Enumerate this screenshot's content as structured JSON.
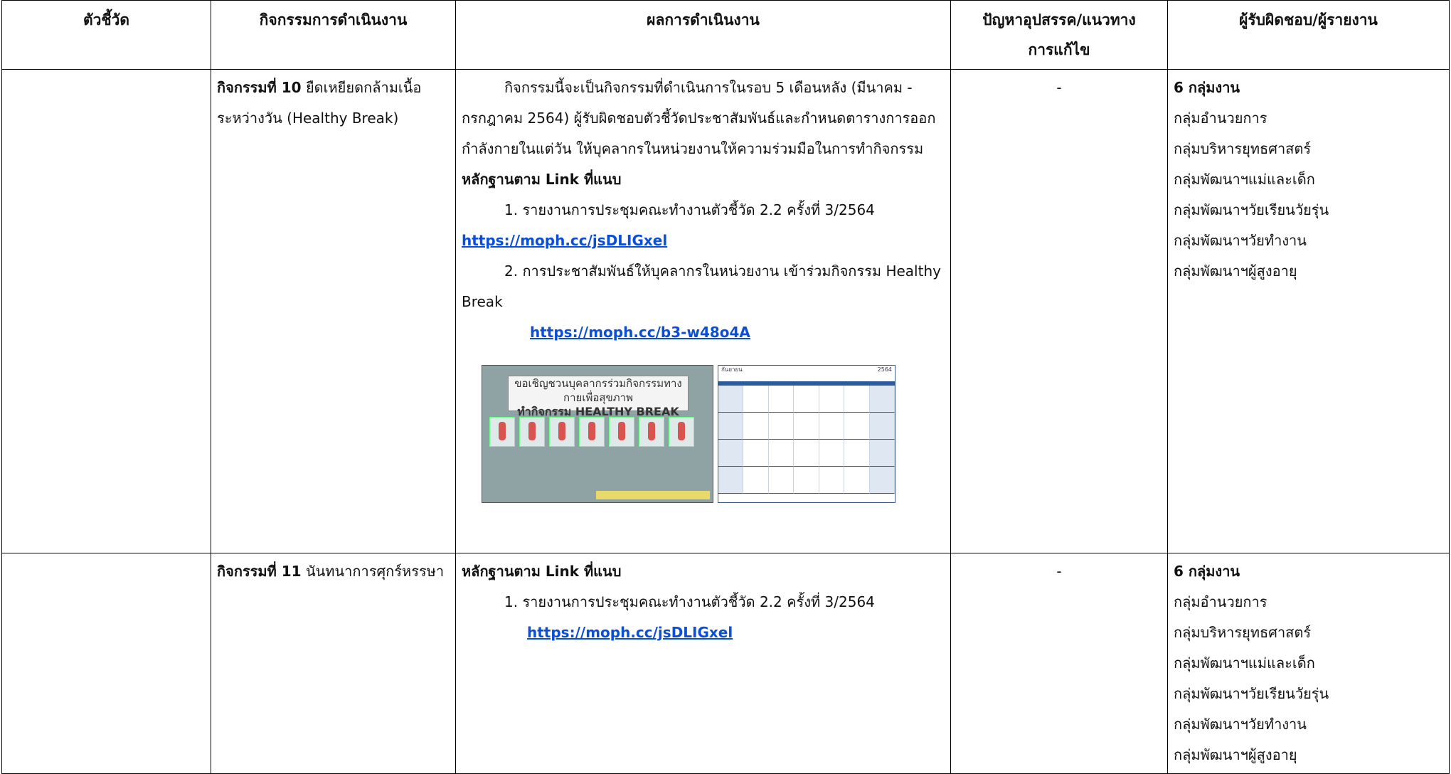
{
  "headers": {
    "indicator": "ตัวชี้วัด",
    "activity": "กิจกรรมการดำเนินงาน",
    "result": "ผลการดำเนินงาน",
    "problem": "ปัญหาอุปสรรค/แนวทางการแก้ไข",
    "owner": "ผู้รับผิดชอบ/ผู้รายงาน"
  },
  "rows": [
    {
      "indicator": "",
      "activity_bold": "กิจกรรมที่ 10",
      "activity_text": " ยืดเหยียดกล้ามเนื้อระหว่างวัน (Healthy Break)",
      "result_para": "กิจกรรมนี้จะเป็นกิจกรรมที่ดำเนินการในรอบ 5 เดือนหลัง (มีนาคม - กรกฎาคม 2564) ผู้รับผิดชอบตัวชี้วัดประชาสัมพันธ์และกำหนดตารางการออกกำลังกายในแต่วัน ให้บุคลากรในหน่วยงานให้ความร่วมมือในการทำกิจกรรม",
      "evidence_title": "หลักฐานตาม Link ที่แนบ",
      "item1": "1. รายงานการประชุมคณะทำงานตัวชี้วัด 2.2 ครั้งที่ 3/2564",
      "link1": "https://moph.cc/jsDLIGxel",
      "item2": "2. การประชาสัมพันธ์ให้บุคลากรในหน่วยงาน เข้าร่วมกิจกรรม Healthy Break",
      "link2": "https://moph.cc/b3-w48o4A",
      "poster_line1": "ขอเชิญชวนบุคลากรร่วมกิจกรรมทางกายเพื่อสุขภาพ",
      "poster_line2": "ทำกิจกรรม HEALTHY BREAK",
      "calendar_month": "กันยายน",
      "calendar_year": "2564",
      "problem": "-",
      "owner_title": "6 กลุ่มงาน",
      "owners": [
        "กลุ่มอำนวยการ",
        "กลุ่มบริหารยุทธศาสตร์",
        "กลุ่มพัฒนาฯแม่และเด็ก",
        "กลุ่มพัฒนาฯวัยเรียนวัยรุ่น",
        "กลุ่มพัฒนาฯวัยทำงาน",
        "กลุ่มพัฒนาฯผู้สูงอายุ"
      ]
    },
    {
      "indicator": "",
      "activity_bold": "กิจกรรมที่ 11",
      "activity_text": " นันทนาการศุกร์หรรษา",
      "evidence_title": "หลักฐานตาม Link ที่แนบ",
      "item1": "1. รายงานการประชุมคณะทำงานตัวชี้วัด 2.2 ครั้งที่ 3/2564",
      "link1": "https://moph.cc/jsDLIGxel",
      "problem": "-",
      "owner_title": "6 กลุ่มงาน",
      "owners": [
        "กลุ่มอำนวยการ",
        "กลุ่มบริหารยุทธศาสตร์",
        "กลุ่มพัฒนาฯแม่และเด็ก",
        "กลุ่มพัฒนาฯวัยเรียนวัยรุ่น",
        "กลุ่มพัฒนาฯวัยทำงาน",
        "กลุ่มพัฒนาฯผู้สูงอายุ"
      ]
    }
  ]
}
